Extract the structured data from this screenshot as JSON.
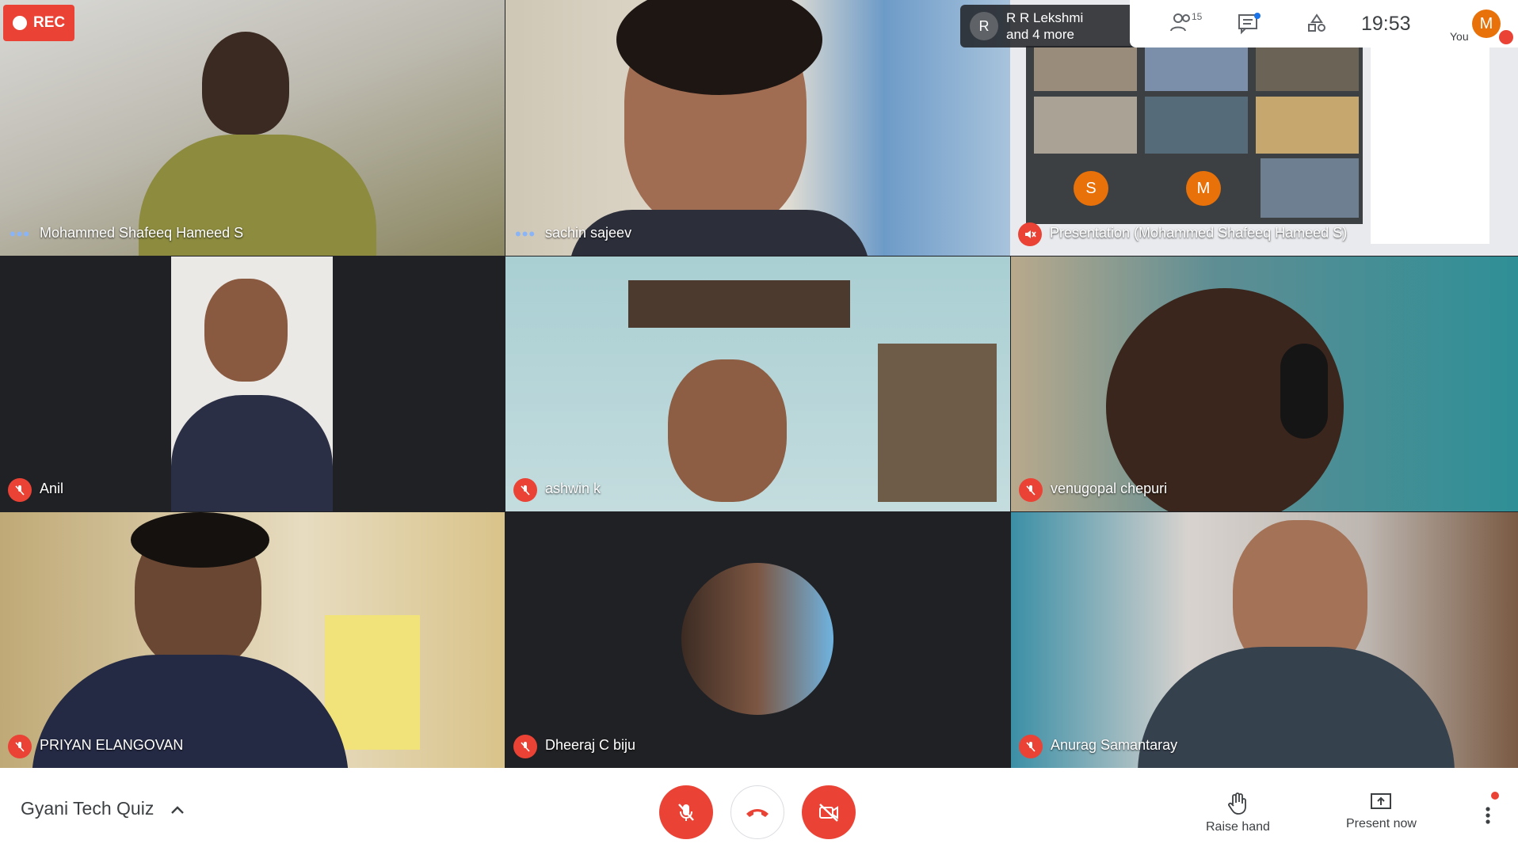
{
  "recording": {
    "label": "REC"
  },
  "pinned": {
    "avatar_letter": "R",
    "line1": "R R Lekshmi",
    "line2": "and 4 more"
  },
  "topbar": {
    "people_count": "15",
    "time": "19:53",
    "self_avatar": "M",
    "self_label": "You"
  },
  "tiles": [
    {
      "name": "Mohammed Shafeeq Hameed S",
      "speaking": true
    },
    {
      "name": "sachin sajeev",
      "speaking": true
    },
    {
      "name": "Presentation (Mohammed Shafeeq Hameed S)",
      "muted": true
    },
    {
      "name": "Anil",
      "muted": true
    },
    {
      "name": "ashwin k",
      "muted": true
    },
    {
      "name": "venugopal chepuri",
      "muted": true
    },
    {
      "name": "PRIYAN ELANGOVAN",
      "muted": true
    },
    {
      "name": "Dheeraj C biju",
      "muted": true
    },
    {
      "name": "Anurag Samantaray",
      "muted": true
    }
  ],
  "presentation_avatars": [
    "S",
    "M"
  ],
  "bottombar": {
    "meeting_title": "Gyani Tech Quiz",
    "raise_hand": "Raise hand",
    "present_now": "Present now"
  },
  "colors": {
    "red": "#ea4335",
    "avatar_orange": "#e8710a",
    "bg": "#202124"
  }
}
